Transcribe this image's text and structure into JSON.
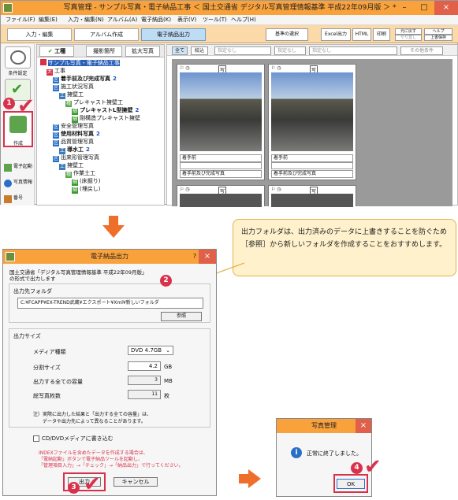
{
  "app": {
    "title": "写真管理 - サンプル写真・電子納品工事 ＜ 国土交通省 デジタル写真管理情報基準 平成22年09月版 ＞ *",
    "menu": [
      "ファイル(F)",
      "編集(E)",
      "入力・編集(N)",
      "アルバム(A)",
      "電子納品(K)",
      "表示(V)",
      "ツール(T)",
      "ヘルプ(H)"
    ],
    "tabs": [
      "入力・編集",
      "アルバム作成",
      "電子納品出力"
    ],
    "toolbar": {
      "standard": "基準の選択",
      "excel": "Excel出力",
      "html": "HTML",
      "print": "印刷",
      "undo": "元に戻す",
      "redo": "やり直し",
      "help": "ヘルプ",
      "save_over": "上書保存"
    },
    "sidebar": {
      "condition": "条件設定",
      "create": "作成",
      "start": "電子起動",
      "photo_info": "写真情報",
      "other": "番号"
    },
    "tree_tabs": [
      "工種",
      "撮影箇所",
      "拡大写真"
    ],
    "tree": [
      {
        "text": "サンプル写真・電子納品工事",
        "icon": "root",
        "indent": 0,
        "style": "sel"
      },
      {
        "text": "工事",
        "icon": "大",
        "indent": 1
      },
      {
        "text": "着手前及び完成写真",
        "icon": "区",
        "indent": 2,
        "count": "2",
        "style": "bold"
      },
      {
        "text": "施工状況写真",
        "icon": "区",
        "indent": 2
      },
      {
        "text": "擁壁工",
        "icon": "工",
        "indent": 3
      },
      {
        "text": "プレキャスト擁壁工",
        "icon": "種",
        "indent": 4
      },
      {
        "text": "プレキャストL型擁壁",
        "icon": "細",
        "indent": 5,
        "count": "2",
        "style": "bold"
      },
      {
        "text": "剛構造プレキャスト擁壁",
        "icon": "細",
        "indent": 5
      },
      {
        "text": "安全管理写真",
        "icon": "区",
        "indent": 2
      },
      {
        "text": "使用材料写真",
        "icon": "区",
        "indent": 2,
        "count": "2",
        "style": "bold"
      },
      {
        "text": "品質管理写真",
        "icon": "区",
        "indent": 2
      },
      {
        "text": "導水工",
        "icon": "工",
        "indent": 3,
        "count": "2",
        "style": "bold"
      },
      {
        "text": "出来形管理写真",
        "icon": "区",
        "indent": 2
      },
      {
        "text": "擁壁工",
        "icon": "工",
        "indent": 3
      },
      {
        "text": "作業土工",
        "icon": "種",
        "indent": 4
      },
      {
        "text": "(床掘り)",
        "icon": "細",
        "indent": 5
      },
      {
        "text": "(埋戻し)",
        "icon": "細",
        "indent": 5
      }
    ],
    "photo_toolbar": {
      "all": "全て",
      "filter": "絞込",
      "unspecified1": "指定なし",
      "unspecified2": "指定なし",
      "unspecified3": "指定なし",
      "other_items": "その他条件"
    },
    "cards": [
      {
        "caption1": "着手前",
        "caption2": "着手前及び完成写真"
      },
      {
        "caption1": "着手前",
        "caption2": "着手前及び完成写真"
      }
    ],
    "card_tag": "写"
  },
  "note": {
    "text": "出力フォルダは、出力済みのデータに上書きすることを防ぐため［参照］から新しいフォルダを作成することをおすすめします。"
  },
  "dialog": {
    "title": "電子納品出力",
    "help": "?",
    "close": "×",
    "intro1": "国土交通省「デジタル写真管理情報基準 平成22年09月版」",
    "intro2": "の形式で出力します",
    "folder_label": "出力先フォルダ",
    "folder_value": "C:¥FCAPP¥EX-TREND武蔵¥エクスポート¥Xml¥新しいフォルダ",
    "browse": "参照",
    "size_label": "出力サイズ",
    "media_label": "メディア種類",
    "media_value": "DVD 4.7GB",
    "split_label": "分割サイズ",
    "split_value": "4.2",
    "split_unit": "GB",
    "total_label": "出力する全ての容量",
    "total_value": "3",
    "total_unit": "MB",
    "count_label": "総写真枚数",
    "count_value": "11",
    "count_unit": "枚",
    "notice1": "注）実際に出力した結果と「出力する全ての容量」は、",
    "notice2": "データや出力先によって異なることがあります。",
    "cd_checkbox": "CD/DVDメディアに書き込む",
    "warning1": "INDEXファイルを含めたデータを作成する場合は、",
    "warning2": "「電納起動」ボタンで電子納品ツールを起動し、",
    "warning3": "「管理項目入力」→「チェック」→「納品出力」で行ってください。",
    "output": "出力",
    "cancel": "キャンセル"
  },
  "done": {
    "title": "写真管理",
    "close": "×",
    "message": "正常に終了しました。",
    "ok": "OK",
    "info_icon": "i"
  },
  "badges": [
    "1",
    "2",
    "3",
    "4"
  ]
}
